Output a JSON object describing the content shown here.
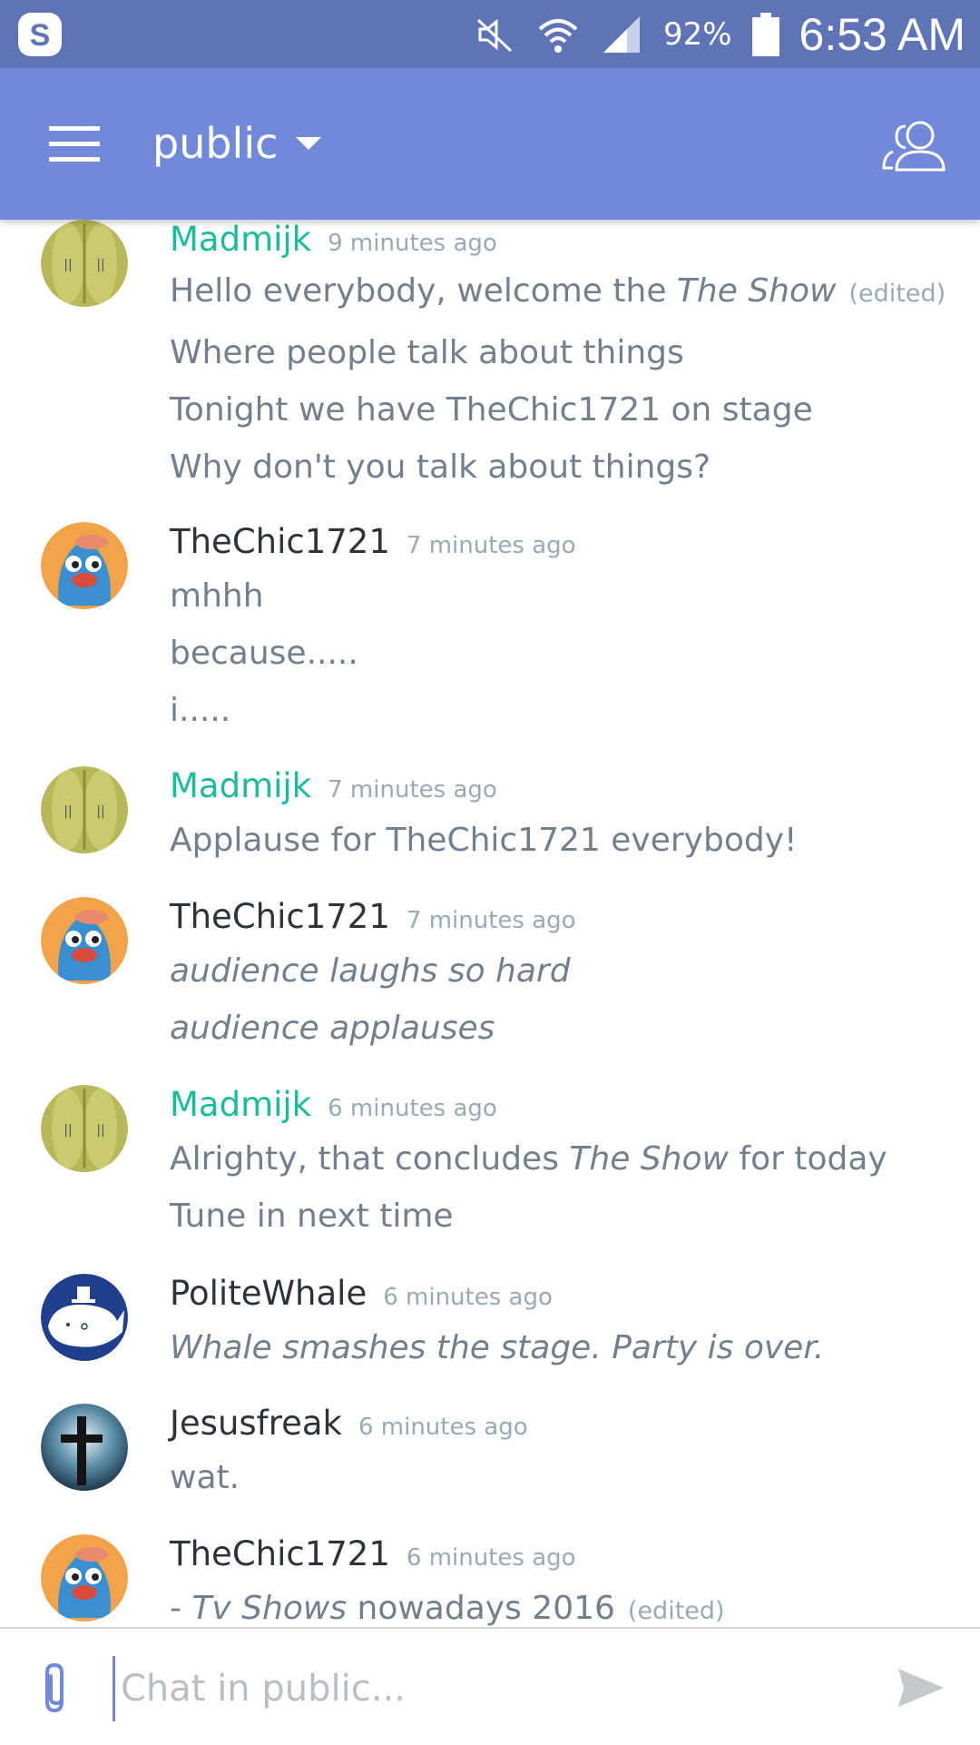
{
  "status_bar": {
    "app_icon": "skype-icon",
    "battery_pct": "92%",
    "time": "6:53 AM"
  },
  "header": {
    "channel": "public",
    "menu_icon": "hamburger-menu-icon",
    "members_icon": "members-icon"
  },
  "messages": [
    {
      "user": "Madmijk",
      "time": "9 minutes ago",
      "avatar": "bread-avatar",
      "lines": [
        "Hello everybody, welcome the ",
        "The Show",
        "(edited)",
        "Where people talk about things",
        "Tonight we have TheChic1721 on stage",
        "Why don't you talk about things?"
      ]
    },
    {
      "user": "TheChic1721",
      "time": "7 minutes ago",
      "avatar": "penguin-avatar",
      "lines": [
        "mhhh",
        "because.....",
        "i....."
      ]
    },
    {
      "user": "Madmijk",
      "time": "7 minutes ago",
      "avatar": "bread-avatar",
      "lines": [
        "Applause for TheChic1721 everybody!"
      ]
    },
    {
      "user": "TheChic1721",
      "time": "7 minutes ago",
      "avatar": "penguin-avatar",
      "lines": [
        "audience laughs so hard",
        "audience applauses"
      ]
    },
    {
      "user": "Madmijk",
      "time": "6 minutes ago",
      "avatar": "bread-avatar",
      "lines": [
        "Alrighty, that concludes ",
        "The Show",
        " for today",
        "Tune in next time"
      ]
    },
    {
      "user": "PoliteWhale",
      "time": "6 minutes ago",
      "avatar": "whale-avatar",
      "lines": [
        "Whale smashes the stage. Party is over."
      ]
    },
    {
      "user": "Jesusfreak",
      "time": "6 minutes ago",
      "avatar": "cross-avatar",
      "lines": [
        "wat."
      ]
    },
    {
      "user": "TheChic1721",
      "time": "6 minutes ago",
      "avatar": "penguin-avatar",
      "lines": [
        "- ",
        "Tv Shows",
        " nowadays 2016",
        "(edited)"
      ]
    }
  ],
  "composer": {
    "placeholder": "Chat in public...",
    "attach_icon": "paperclip-icon",
    "send_icon": "send-icon"
  },
  "colors": {
    "status_bar": "#5f73b7",
    "app_bar": "#7189d8",
    "username_teal": "#1abc9c",
    "username_dark": "#2e3338",
    "message_text": "#737f8d",
    "timestamp": "#99aab5"
  }
}
